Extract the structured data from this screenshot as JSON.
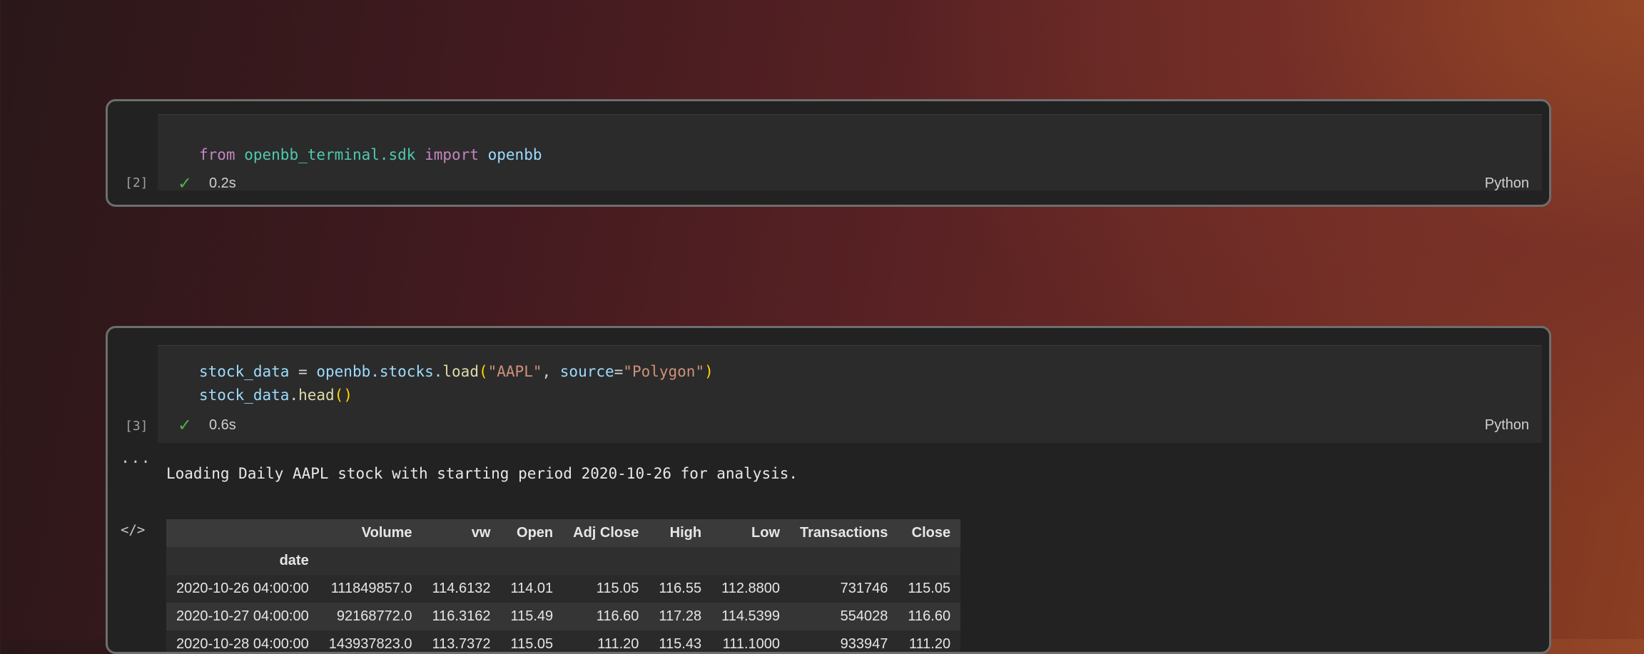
{
  "cell1": {
    "exec_count": "[2]",
    "code": {
      "kw_from": "from",
      "module": "openbb_terminal.sdk",
      "kw_import": "import",
      "name": "openbb"
    },
    "status_icon": "check-icon",
    "duration": "0.2s",
    "language": "Python"
  },
  "cell2": {
    "exec_count": "[3]",
    "code": {
      "line1": {
        "var": "stock_data",
        "eq": " = ",
        "obj": "openbb.stocks.",
        "fn": "load",
        "open": "(",
        "arg1": "\"AAPL\"",
        "sep": ", ",
        "kwarg": "source",
        "eq2": "=",
        "arg2": "\"Polygon\"",
        "close": ")"
      },
      "line2": {
        "var": "stock_data",
        "dot": ".",
        "fn": "head",
        "parens": "()"
      }
    },
    "status_icon": "check-icon",
    "duration": "0.6s",
    "language": "Python",
    "output_menu": "...",
    "output_icon": "</>",
    "output_text": "Loading Daily AAPL stock with starting period 2020-10-26 for analysis.",
    "table": {
      "columns": [
        "Volume",
        "vw",
        "Open",
        "Adj Close",
        "High",
        "Low",
        "Transactions",
        "Close"
      ],
      "index_name": "date",
      "rows": [
        [
          "2020-10-26 04:00:00",
          "111849857.0",
          "114.6132",
          "114.01",
          "115.05",
          "116.55",
          "112.8800",
          "731746",
          "115.05"
        ],
        [
          "2020-10-27 04:00:00",
          "92168772.0",
          "116.3162",
          "115.49",
          "116.60",
          "117.28",
          "114.5399",
          "554028",
          "116.60"
        ],
        [
          "2020-10-28 04:00:00",
          "143937823.0",
          "113.7372",
          "115.05",
          "111.20",
          "115.43",
          "111.1000",
          "933947",
          "111.20"
        ]
      ]
    }
  }
}
